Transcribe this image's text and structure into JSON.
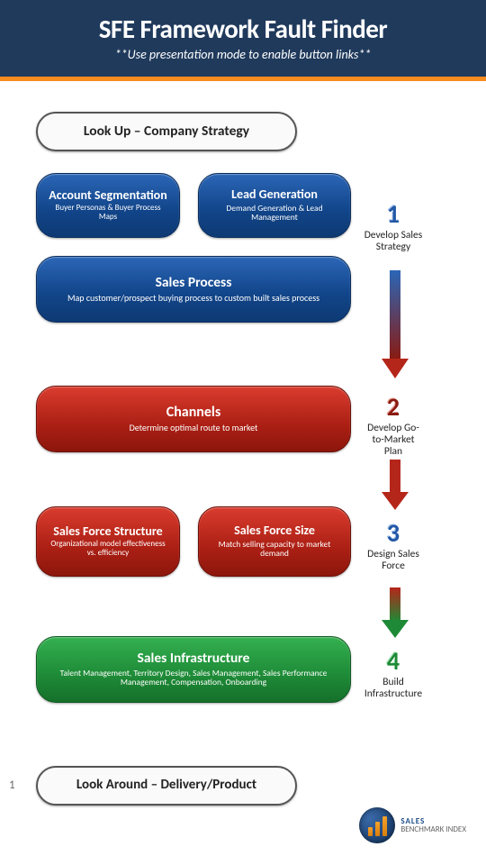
{
  "header": {
    "title": "SFE Framework Fault Finder",
    "subtitle": "**Use presentation mode to enable button links**"
  },
  "lookup": {
    "label": "Look Up – Company Strategy"
  },
  "acct": {
    "title": "Account Segmentation",
    "sub": "Buyer Personas & Buyer Process Maps"
  },
  "lead": {
    "title": "Lead Generation",
    "sub": "Demand Generation & Lead Management"
  },
  "salesproc": {
    "title": "Sales Process",
    "sub": "Map customer/prospect buying process to custom built sales process"
  },
  "channels": {
    "title": "Channels",
    "sub": "Determine optimal route to market"
  },
  "sfstruct": {
    "title": "Sales Force Structure",
    "sub": "Organizational model effectiveness vs. efficiency"
  },
  "sfsize": {
    "title": "Sales Force Size",
    "sub": "Match selling capacity to market demand"
  },
  "infra": {
    "title": "Sales Infrastructure",
    "sub": "Talent Management, Territory Design, Sales Management, Sales Performance Management, Compensation, Onboarding"
  },
  "lookaround": {
    "label": "Look Around – Delivery/Product"
  },
  "steps": {
    "s1": {
      "num": "1",
      "label": "Develop Sales Strategy"
    },
    "s2": {
      "num": "2",
      "label": "Develop Go-to-Market Plan"
    },
    "s3": {
      "num": "3",
      "label": "Design Sales Force"
    },
    "s4": {
      "num": "4",
      "label": "Build Infrastructure"
    }
  },
  "page": "1",
  "footer": {
    "brand_top": "SALES",
    "brand_bottom": "BENCHMARK INDEX"
  }
}
